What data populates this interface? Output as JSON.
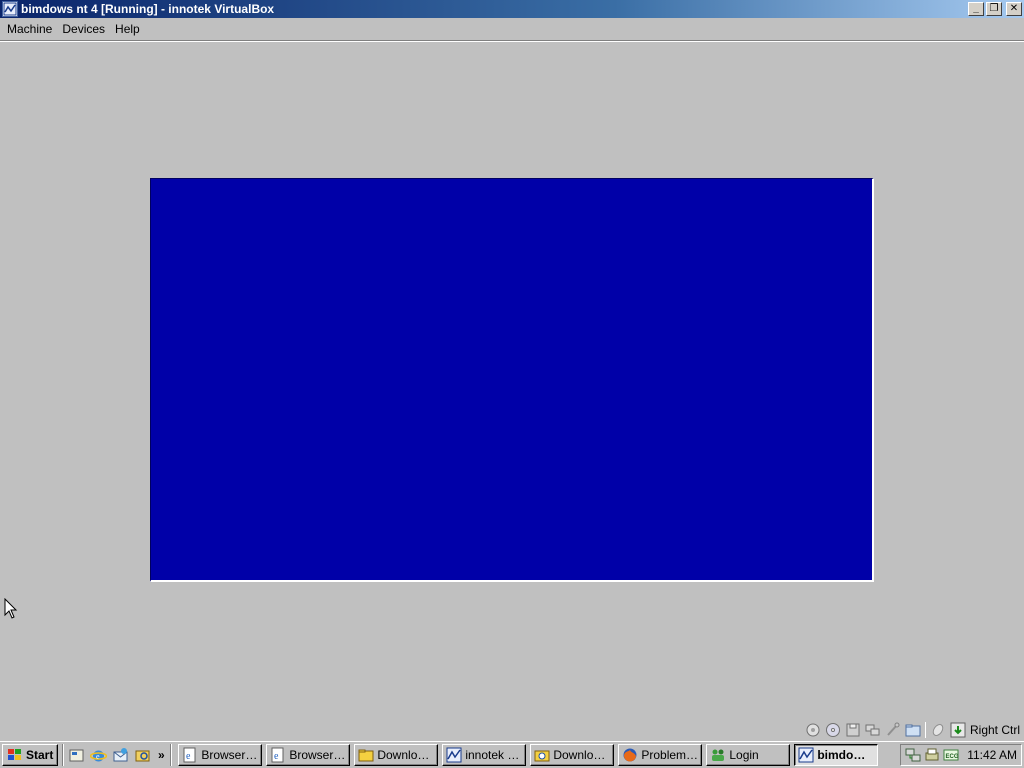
{
  "window": {
    "title": "bimdows nt 4 [Running] - innotek VirtualBox",
    "icon": "virtualbox-icon",
    "controls": {
      "minimize": "_",
      "restore": "❐",
      "close": "✕"
    }
  },
  "menu": {
    "items": [
      {
        "label": "Machine"
      },
      {
        "label": "Devices"
      },
      {
        "label": "Help"
      }
    ]
  },
  "vm_screen": {
    "background": "#0000a8"
  },
  "statusbar": {
    "icons": [
      "hard-disk-icon",
      "cd-icon",
      "floppy-icon",
      "network-icon",
      "usb-icon",
      "shared-folders-icon",
      "mouse-integration-icon",
      "host-key-icon"
    ],
    "host_key_label": "Right Ctrl"
  },
  "taskbar": {
    "start_label": "Start",
    "quick_launch": [
      "show-desktop-icon",
      "internet-explorer-icon",
      "outlook-express-icon",
      "explorer-icon"
    ],
    "quick_more": "»",
    "tasks": [
      {
        "label": "Browservic...",
        "icon": "ie-page-icon",
        "active": false
      },
      {
        "label": "Browservic...",
        "icon": "ie-page-icon",
        "active": false
      },
      {
        "label": "Downloads",
        "icon": "folder-icon",
        "active": false
      },
      {
        "label": "innotek Vir...",
        "icon": "virtualbox-icon",
        "active": false
      },
      {
        "label": "Downloads",
        "icon": "search-folder-icon",
        "active": false
      },
      {
        "label": "Problem lo...",
        "icon": "firefox-icon",
        "active": false
      },
      {
        "label": "Login",
        "icon": "users-icon",
        "active": false
      },
      {
        "label": "bimdows...",
        "icon": "virtualbox-icon",
        "active": true
      }
    ],
    "tray": {
      "icons": [
        "network-tray-icon",
        "printer-tray-icon",
        "antivirus-tray-icon"
      ],
      "clock": "11:42 AM"
    }
  },
  "colors": {
    "desktop": "#c0c0c0",
    "title_start": "#0a246a",
    "title_end": "#a6caf0",
    "vm_blue": "#0000a8"
  }
}
